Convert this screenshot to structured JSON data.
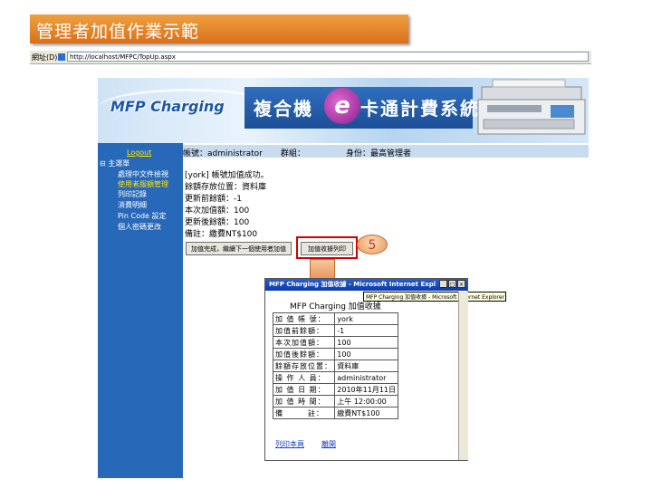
{
  "slide": {
    "title": "管理者加值作業示範"
  },
  "browser": {
    "address_label": "網址(D)",
    "url": "http://localhost/MFPC/TopUp.aspx"
  },
  "banner": {
    "logo": "MFP Charging",
    "system_title_left": "複合機",
    "system_title_mid": "e",
    "system_title_right": "卡通計費系統"
  },
  "nav": {
    "logout": "Logout",
    "main_menu": "主選單",
    "items": [
      "處理中文件檢視",
      "使用者服額管理",
      "列印記錄",
      "消費明細",
      "Pin Code 設定",
      "個人密碼更改"
    ],
    "active_index": 1
  },
  "info": {
    "account": "帳號：administrator",
    "group": "群組：",
    "role": "身份：最高管理者"
  },
  "content": {
    "lines": [
      "[york] 帳號加值成功。",
      "餘額存放位置：資料庫",
      "更新前餘額：-1",
      "本次加值額：100",
      "更新後餘額：100",
      "備註：繳費NT$100"
    ]
  },
  "buttons": {
    "next_user": "加值完成，繼續下一個使用者加值",
    "print_receipt": "加值收據列印"
  },
  "step_number": "5",
  "popup": {
    "window_title": "MFP Charging 加值收據 - Microsoft Internet Expl",
    "tooltip": "MFP Charging 加值收據 - Microsoft Internet Explorer",
    "receipt_title": "MFP Charging 加值收據",
    "rows": [
      {
        "label": "加 值 帳 號：",
        "value": "york"
      },
      {
        "label": "加值前餘額：",
        "value": "-1"
      },
      {
        "label": "本次加值額：",
        "value": "100"
      },
      {
        "label": "加值後餘額：",
        "value": "100"
      },
      {
        "label": "餘額存放位置：",
        "value": "資料庫"
      },
      {
        "label": "操 作 人 員：",
        "value": "administrator"
      },
      {
        "label": "加 值 日 期：",
        "value": "2010年11月11日"
      },
      {
        "label": "加 值 時 間：",
        "value": "上午 12:00:00"
      },
      {
        "label": "備　　　註：",
        "value": "繳費NT$100"
      }
    ],
    "print_link": "列印本頁",
    "close_link": "離開"
  }
}
